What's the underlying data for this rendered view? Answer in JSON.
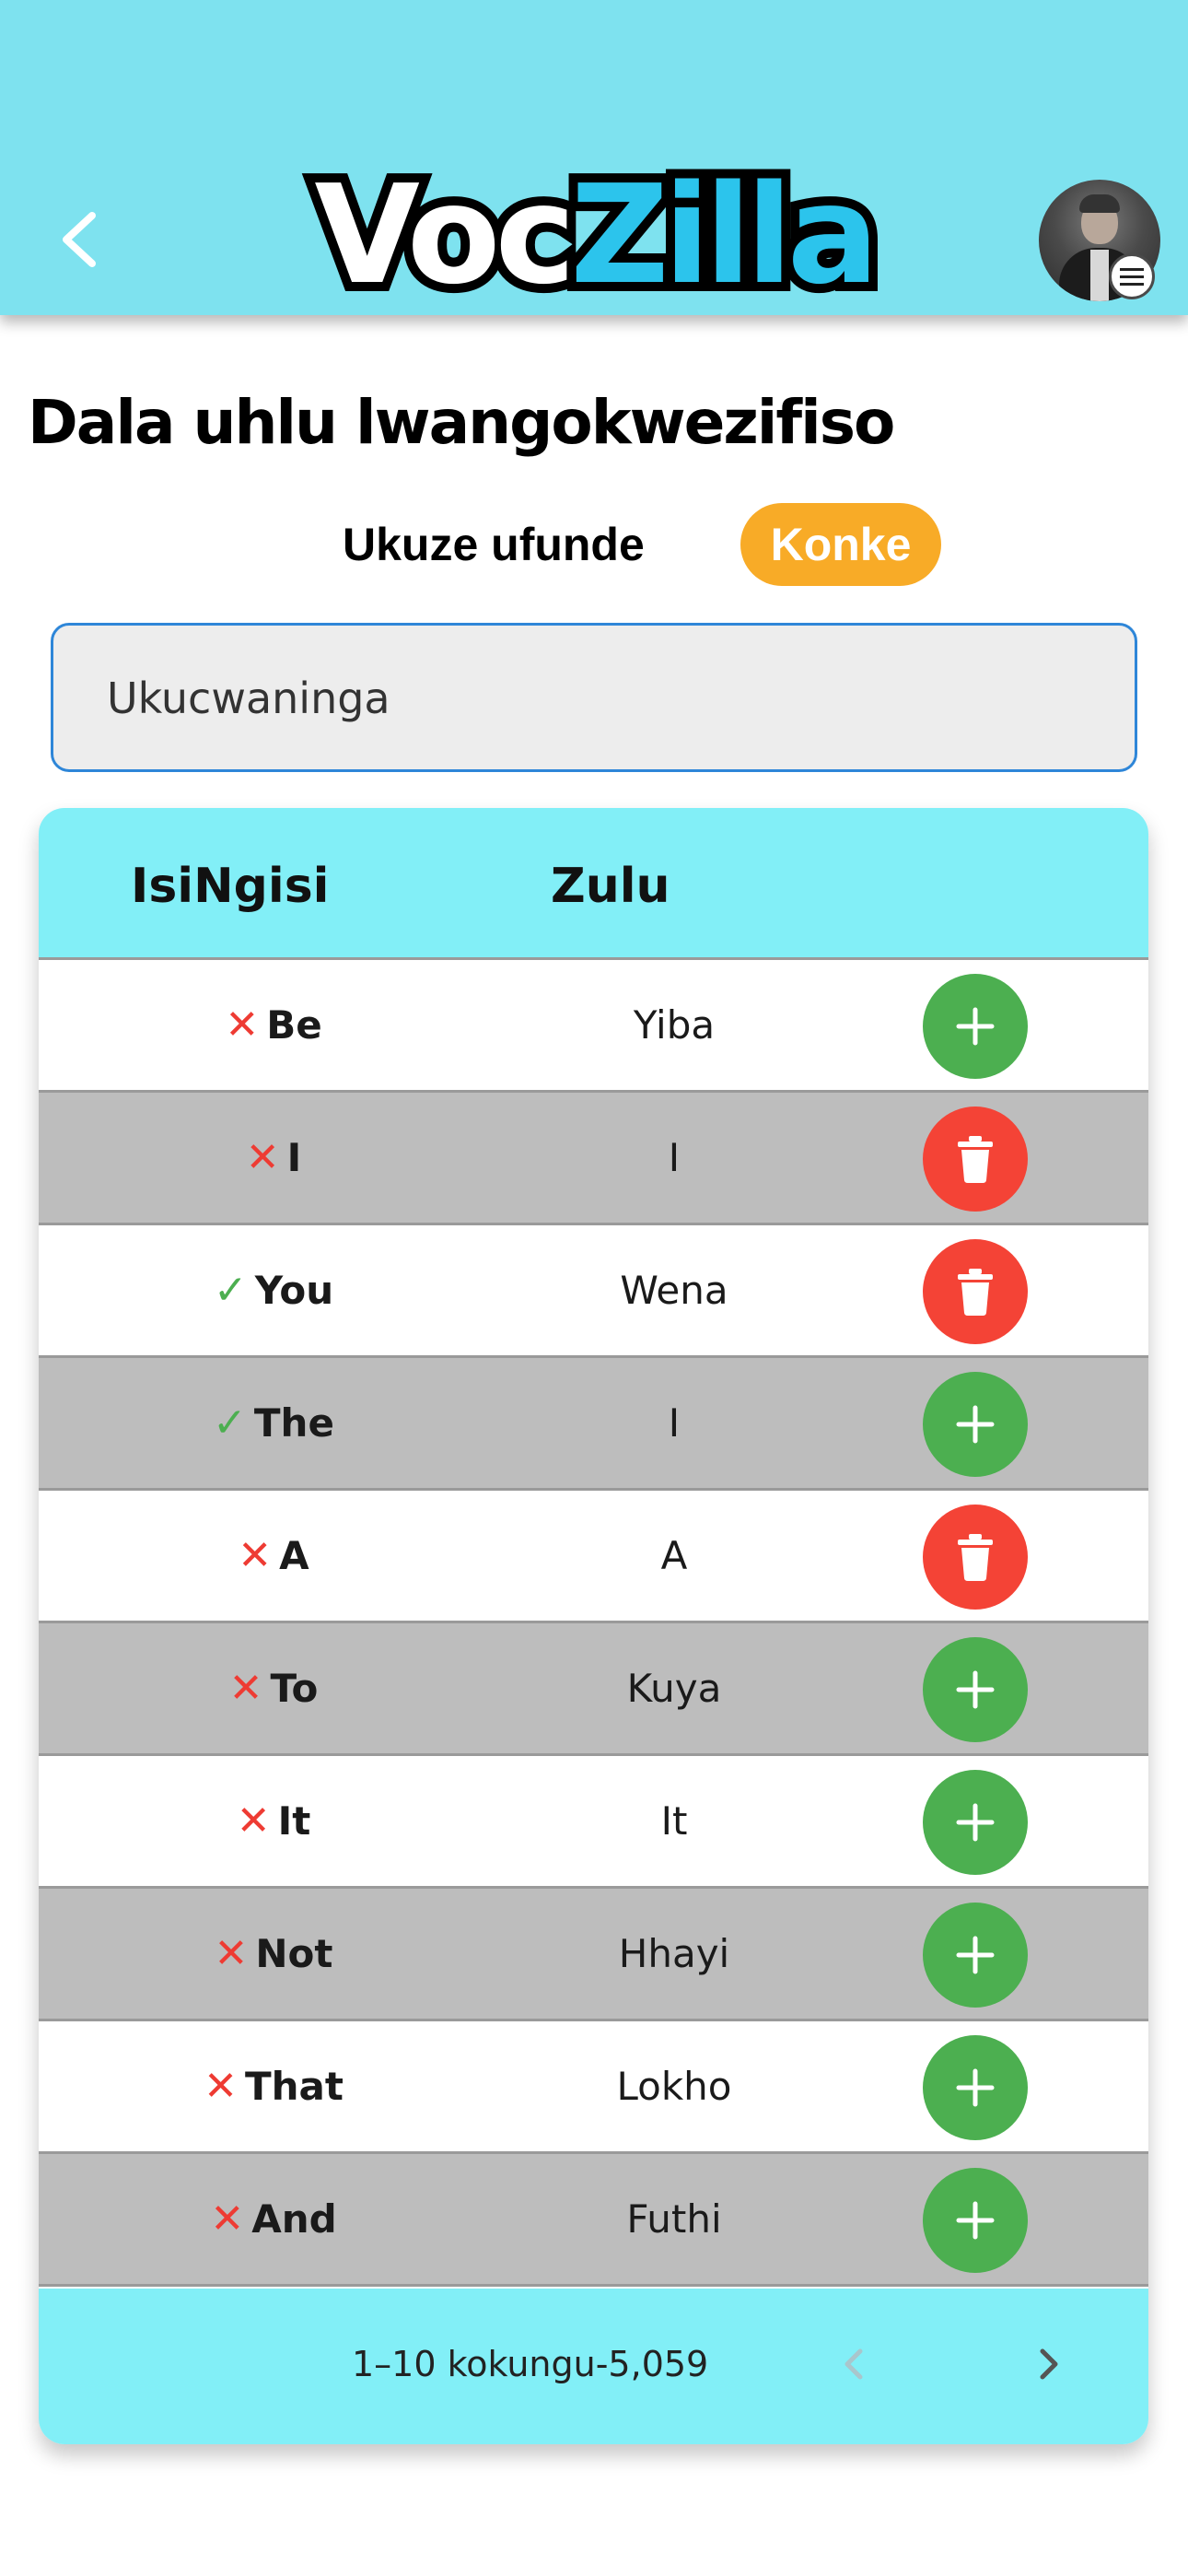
{
  "header": {
    "logo_part1": "Voc",
    "logo_part2": "Zilla",
    "icons": {
      "back": "chevron-left-icon",
      "menu": "hamburger-menu-icon"
    },
    "colors": {
      "background": "#7ee2ef",
      "logo_accent": "#2cc4ec"
    }
  },
  "page_title": "Dala uhlu lwangokwezifiso",
  "filter": {
    "label": "Ukuze ufunde",
    "chip": "Konke",
    "chip_color": "#f8ab27"
  },
  "search": {
    "placeholder": "Ukucwaninga"
  },
  "table": {
    "columns": [
      "IsiNgisi",
      "Zulu"
    ],
    "rows": [
      {
        "english": "Be",
        "zulu": "Yiba",
        "status": "✕",
        "status_kind": "not-learned",
        "action": "add"
      },
      {
        "english": "I",
        "zulu": "I",
        "status": "✕",
        "status_kind": "not-learned",
        "action": "delete"
      },
      {
        "english": "You",
        "zulu": "Wena",
        "status": "✓",
        "status_kind": "learned",
        "action": "delete"
      },
      {
        "english": "The",
        "zulu": "I",
        "status": "✓",
        "status_kind": "learned",
        "action": "add"
      },
      {
        "english": "A",
        "zulu": "A",
        "status": "✕",
        "status_kind": "not-learned",
        "action": "delete"
      },
      {
        "english": "To",
        "zulu": "Kuya",
        "status": "✕",
        "status_kind": "not-learned",
        "action": "add"
      },
      {
        "english": "It",
        "zulu": "It",
        "status": "✕",
        "status_kind": "not-learned",
        "action": "add"
      },
      {
        "english": "Not",
        "zulu": "Hhayi",
        "status": "✕",
        "status_kind": "not-learned",
        "action": "add"
      },
      {
        "english": "That",
        "zulu": "Lokho",
        "status": "✕",
        "status_kind": "not-learned",
        "action": "add"
      },
      {
        "english": "And",
        "zulu": "Futhi",
        "status": "✕",
        "status_kind": "not-learned",
        "action": "add"
      }
    ],
    "colors": {
      "header_bg": "#82eff7",
      "add": "#4caf50",
      "delete": "#f44336",
      "row_alt": "#bdbdbd"
    }
  },
  "pagination": {
    "text": "1–10 kokungu-5,059",
    "prev_icon": "chevron-left-icon",
    "next_icon": "chevron-right-icon"
  }
}
